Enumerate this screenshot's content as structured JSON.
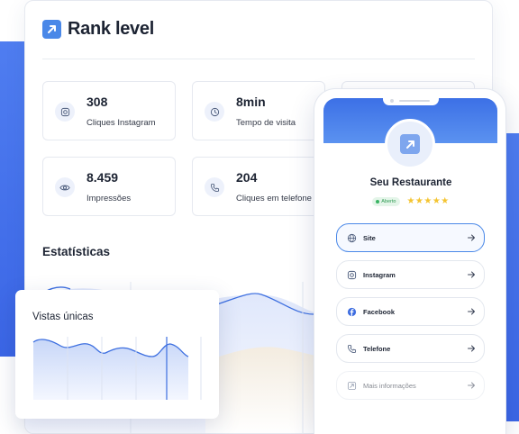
{
  "brand": {
    "name": "Rank level",
    "color": "#4a88e8",
    "logo_icon": "arrow-up-right-icon"
  },
  "stats": [
    {
      "value": "308",
      "label": "Cliques Instagram",
      "icon": "instagram-icon"
    },
    {
      "value": "8min",
      "label": "Tempo de visita",
      "icon": "clock-icon"
    },
    {
      "value": "8.459",
      "label": "Impressões",
      "icon": "eye-icon"
    },
    {
      "value": "204",
      "label": "Cliques em telefone",
      "icon": "phone-icon"
    }
  ],
  "statistics": {
    "title": "Estatísticas"
  },
  "mini_chart": {
    "title": "Vistas únicas"
  },
  "phone": {
    "restaurant_name": "Seu Restaurante",
    "status_badge": "Aberto",
    "stars": "★★★★★",
    "links": [
      {
        "label": "Site",
        "icon": "globe-icon",
        "active": true
      },
      {
        "label": "Instagram",
        "icon": "instagram-icon"
      },
      {
        "label": "Facebook",
        "icon": "facebook-icon"
      },
      {
        "label": "Telefone",
        "icon": "phone-icon"
      },
      {
        "label": "Mais informações",
        "icon": "info-icon",
        "faded": true
      }
    ]
  },
  "colors": {
    "accent": "#4a88e8",
    "accent_dark": "#3b66e6",
    "open_green": "#39b463",
    "stars": "#f4c430"
  }
}
